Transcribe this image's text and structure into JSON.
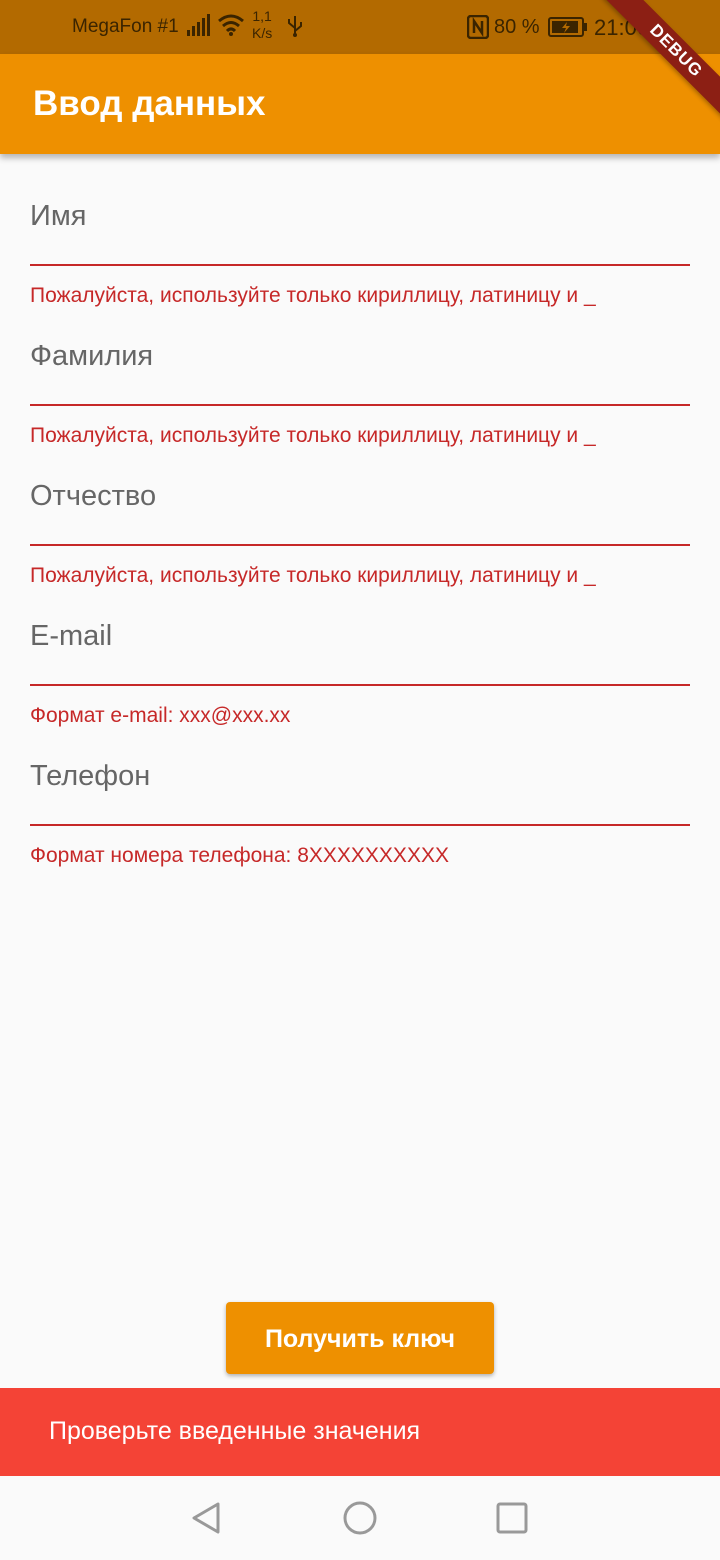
{
  "status_bar": {
    "carrier": "MegaFon #1",
    "speed_value": "1,1",
    "speed_unit": "K/s",
    "battery_percent": "80 %",
    "time": "21:06"
  },
  "debug_label": "DEBUG",
  "app_bar": {
    "title": "Ввод данных"
  },
  "form": {
    "fields": [
      {
        "label": "Имя",
        "error": "Пожалуйста, используйте только кириллицу, латиницу и _"
      },
      {
        "label": "Фамилия",
        "error": "Пожалуйста, используйте только кириллицу, латиницу и _"
      },
      {
        "label": "Отчество",
        "error": "Пожалуйста, используйте только кириллицу, латиницу и _"
      },
      {
        "label": "E-mail",
        "error": "Формат e-mail: xxx@xxx.xx"
      },
      {
        "label": "Телефон",
        "error": "Формат номера телефона: 8XXXXXXXXXX"
      }
    ]
  },
  "submit_label": "Получить ключ",
  "snackbar": {
    "message": "Проверьте введенные значения"
  },
  "colors": {
    "accent": "#ee9000",
    "error": "#c62828",
    "snackbar": "#f44336",
    "status_bar": "#b36a00"
  },
  "icons": {
    "status": [
      "signal-icon",
      "wifi-icon",
      "usb-icon",
      "nfc-icon",
      "battery-icon"
    ],
    "nav": [
      "back-icon",
      "home-icon",
      "recent-apps-icon"
    ]
  }
}
